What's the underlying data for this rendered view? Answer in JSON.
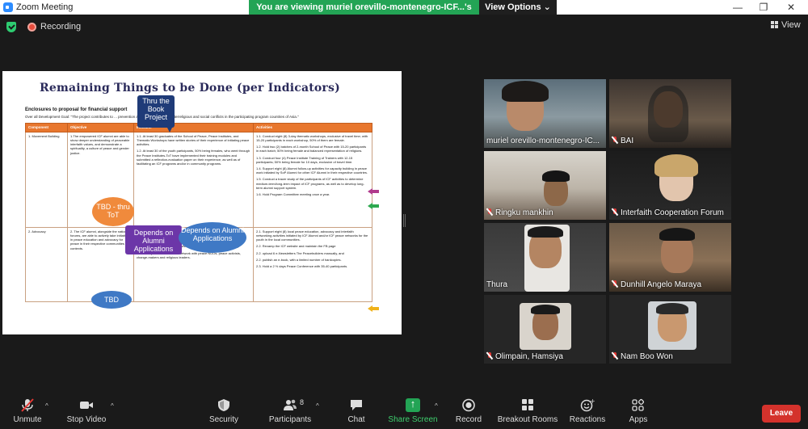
{
  "window": {
    "app_title": "Zoom Meeting",
    "viewing_banner": "You are viewing muriel orevillo-montenegro-ICF...'s screen",
    "view_options_label": "View Options"
  },
  "infobar": {
    "recording_label": "Recording",
    "view_label": "View"
  },
  "slide": {
    "title": "Remaining Things to be Done (per Indicators)",
    "enclosure": "Enclosures to proposal for financial support",
    "goal": "Over all Development Goal: \"The project contributes to ... prevention and transformation of interreligious and social conflicts in the participating program countries of Asia.\"",
    "headers": [
      "Component",
      "Objective",
      "Indicator",
      "Activities"
    ],
    "rows": [
      {
        "component": "1. Movement Building",
        "objective": "1.The empowered ICF alumni are able to show deeper understanding of peaceable interfaith values, and demonstrate a spirituality, a culture of peace and gender justice.",
        "indicator": [
          "1.1. At least 30 graduates of the School of Peace, Peace Institutes, and Thematic Workshops have written stories of their experience of initiating peace activities.",
          "1.2. At least 30 of the youth participants, 50% being females, who went through the Peace Institutes-ToT have implemented their training modules and submitted a reflection-evaluation paper on their experience, as well as of facilitating an ICF programs and/or in community programs."
        ],
        "activities": [
          "1.1. Conduct eight (8) 3-day thematic workshops, exclusive of travel time; with 15-20 participants in each workshop, 50% of them are female.",
          "1.2. Hold two (2) batches of 2-month School of Peace with 15-20 participants in each batch; 50% being female and balanced representation of religions.",
          "1.3. Conduct four (4) Peace Institute Training of Trainers with 12-15 participants; 50% being female for 10 days, exclusive of travel time.",
          "1.4. Support eight (8) Alumni follow-up activities for capacity building in peace work initiated by SoP Alumni for other ICF Alumni in their respective countries.",
          "1.5. Conduct a tracer study of the participants of ICF activities to determine medium-term/long-term impact of ICF programs, as well as to develop long-term alumni support system.",
          "1.6. Hold Program Committee meeting once a year."
        ]
      },
      {
        "component": "2. Advocacy",
        "objective": "2. The ICF alumni, alongside the national forums, are able to actively take initiative in peace education and advocacy for peace in their respective communities or contexts.",
        "indicator": [
          "2.1. Eight (8) local interfaith peace education and advocacy are conducted successfully by ICF alumni in eight countries.",
          "2.2. A well-received advocacy program indicated by wide readership of ICF publications (webpage: 10,000 visitors and Facebook page-3,000 likes).",
          "2.3. An expanded ICF Alumni network with peace NGOs, peace activists, change-makers and religious leaders."
        ],
        "activities": [
          "2.1. Support eight (8) local peace education, advocacy and interfaith networking activities initiated by ICF Alumni and/or ICF peace networks for the youth in the local communities.",
          "2.2. Revamp the ICF website and maintain the FB page",
          "2.2. upload 6 e-Newsletters The Peacebuilders manually, and",
          "2.2. publish an e-book, with a limited number of hardcopies.",
          "2.3. Hold a 2 ½ days Peace Conference with 35-40 participants."
        ]
      }
    ],
    "callouts": {
      "book": "Thru the Book Project",
      "tbd1": "TBD - thru ToT",
      "depends1": "Depends on Alumni Applications",
      "depends2": "Depends on Alumni Applications",
      "tbd2": "TBD"
    }
  },
  "participants": [
    {
      "name": "muriel orevillo-montenegro-IC...",
      "muted": false,
      "active": false
    },
    {
      "name": "BAI",
      "muted": true,
      "active": false
    },
    {
      "name": "Ringku mankhin",
      "muted": true,
      "active": false
    },
    {
      "name": "Interfaith Cooperation Forum",
      "muted": true,
      "active": false
    },
    {
      "name": "Thura",
      "muted": false,
      "active": true
    },
    {
      "name": "Dunhill Angelo Maraya",
      "muted": true,
      "active": false
    },
    {
      "name": "Olimpain, Hamsiya",
      "muted": true,
      "active": false
    },
    {
      "name": "Nam Boo Won",
      "muted": true,
      "active": false
    }
  ],
  "toolbar": {
    "unmute": "Unmute",
    "stop_video": "Stop Video",
    "security": "Security",
    "participants": "Participants",
    "participants_count": "8",
    "chat": "Chat",
    "share_screen": "Share Screen",
    "record": "Record",
    "breakout_rooms": "Breakout Rooms",
    "reactions": "Reactions",
    "apps": "Apps",
    "leave": "Leave"
  },
  "colors": {
    "banner_green": "#23a455",
    "leave_red": "#d4322c",
    "active_speaker": "#d6e24a",
    "table_header_orange": "#e8772e"
  }
}
